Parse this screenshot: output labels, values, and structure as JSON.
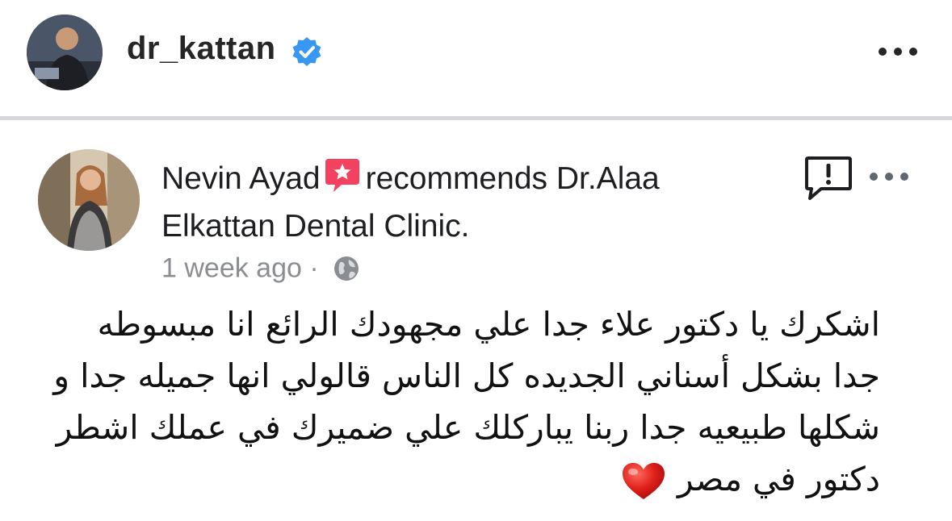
{
  "account": {
    "username": "dr_kattan",
    "verified": true,
    "avatar_icon": "profile-photo",
    "more_icon": "more-horizontal-icon"
  },
  "review": {
    "author": "Nevin Ayad",
    "recommend_icon": "recommend-star-icon",
    "recommend_color": "#f3425f",
    "text_line1": "recommends Dr.Alaa",
    "text_line2": "Elkattan Dental Clinic.",
    "time": "1 week ago",
    "separator": "·",
    "privacy_icon": "globe-icon",
    "report_icon": "report-icon",
    "body_lines": [
      "اشكرك يا دكتور علاء جدا علي مجهودك الرائع انا مبسوطه",
      "جدا بشكل أسناني الجديده كل الناس قالولي انها جميله جدا و",
      "شكلها طبيعيه جدا ربنا يباركلك علي ضميرك في عملك اشطر",
      "دكتور في مصر"
    ],
    "body_emoji": "heart-icon"
  },
  "colors": {
    "verified_blue": "#3897f0",
    "muted_text": "#8a8d91",
    "heart_red": "#e0201b"
  }
}
